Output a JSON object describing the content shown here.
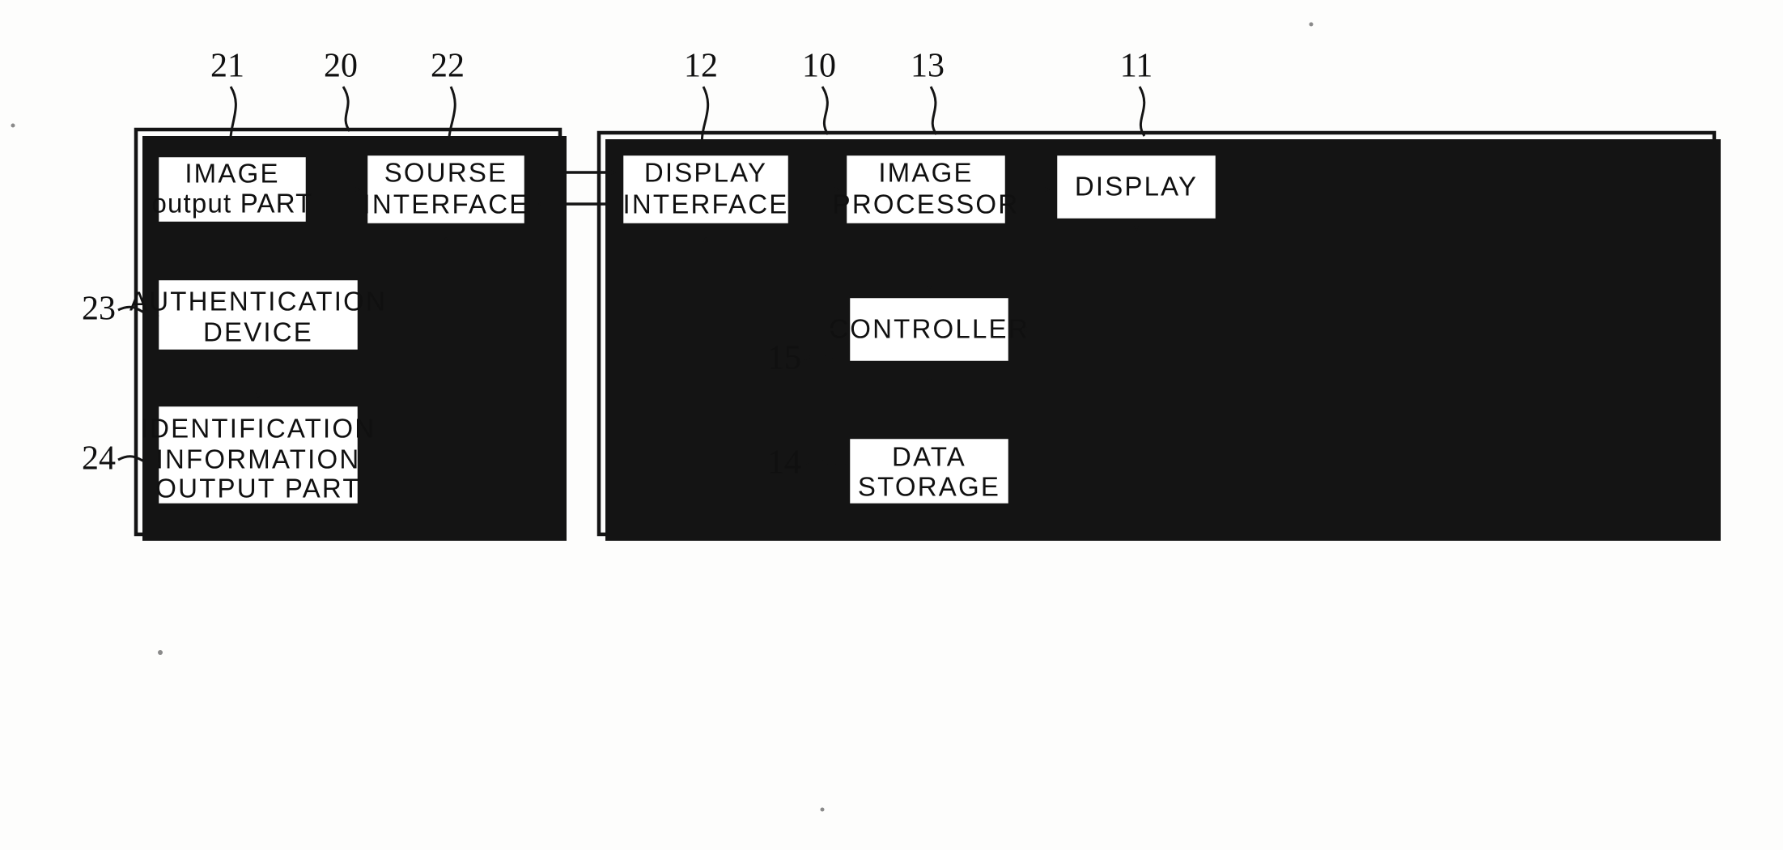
{
  "figure": {
    "type": "patent-block-diagram",
    "background_color": "#fdfdfc",
    "line_color": "#141414"
  },
  "panels": [
    {
      "id": "source-panel",
      "ref": "20",
      "ref_label": "20"
    },
    {
      "id": "display-panel",
      "ref": "10",
      "ref_label": "10"
    }
  ],
  "blocks": {
    "image_output_part": {
      "ref": "21",
      "lines": [
        "IMAGE",
        "output PART"
      ]
    },
    "sourse_interface": {
      "ref": "22",
      "lines": [
        "SOURSE",
        "INTERFACE"
      ]
    },
    "authentication_device": {
      "ref": "23",
      "lines": [
        "AUTHENTICATION",
        "DEVICE"
      ]
    },
    "identification_information_output_part": {
      "ref": "24",
      "lines": [
        "IDENTIFICATION",
        "INFORMATION",
        "OUTPUT PART"
      ]
    },
    "display_interface": {
      "ref": "12",
      "lines": [
        "DISPLAY",
        "INTERFACE"
      ]
    },
    "image_processor": {
      "ref": "13",
      "lines": [
        "IMAGE",
        "PROCESSOR"
      ]
    },
    "display": {
      "ref": "11",
      "lines": [
        "DISPLAY"
      ]
    },
    "controller": {
      "ref": "15",
      "lines": [
        "CONTROLLER"
      ]
    },
    "data_storage": {
      "ref": "14",
      "lines": [
        "DATA",
        "STORAGE"
      ]
    }
  },
  "reference_numerals": {
    "r21": "21",
    "r20": "20",
    "r22": "22",
    "r12": "12",
    "r10": "10",
    "r13": "13",
    "r11": "11",
    "r23": "23",
    "r24": "24",
    "r15": "15",
    "r14": "14"
  },
  "connections": [
    {
      "from": "image_output_part",
      "to": "sourse_interface",
      "style": "solid-arrow"
    },
    {
      "from": "sourse_interface",
      "to": "display_interface",
      "style": "solid-arrow"
    },
    {
      "from": "display_interface",
      "to": "sourse_interface",
      "style": "solid-arrow"
    },
    {
      "from": "identification_information_output_part",
      "to": "sourse_interface",
      "style": "solid-arrow"
    },
    {
      "from": "authentication_device",
      "to": "identification_information_output_part",
      "style": "dashed-arrow"
    },
    {
      "from": "display_interface",
      "to": "image_processor",
      "style": "solid-arrow"
    },
    {
      "from": "image_processor",
      "to": "display",
      "style": "solid-arrow"
    },
    {
      "from": "controller",
      "to": "display_interface",
      "style": "solid-arrow"
    },
    {
      "from": "controller",
      "to": "image_processor",
      "style": "dashed-bidirectional"
    },
    {
      "from": "controller",
      "to": "data_storage",
      "style": "dashed-bidirectional"
    },
    {
      "from": "display",
      "to": "controller",
      "style": "solid-arrow"
    }
  ]
}
